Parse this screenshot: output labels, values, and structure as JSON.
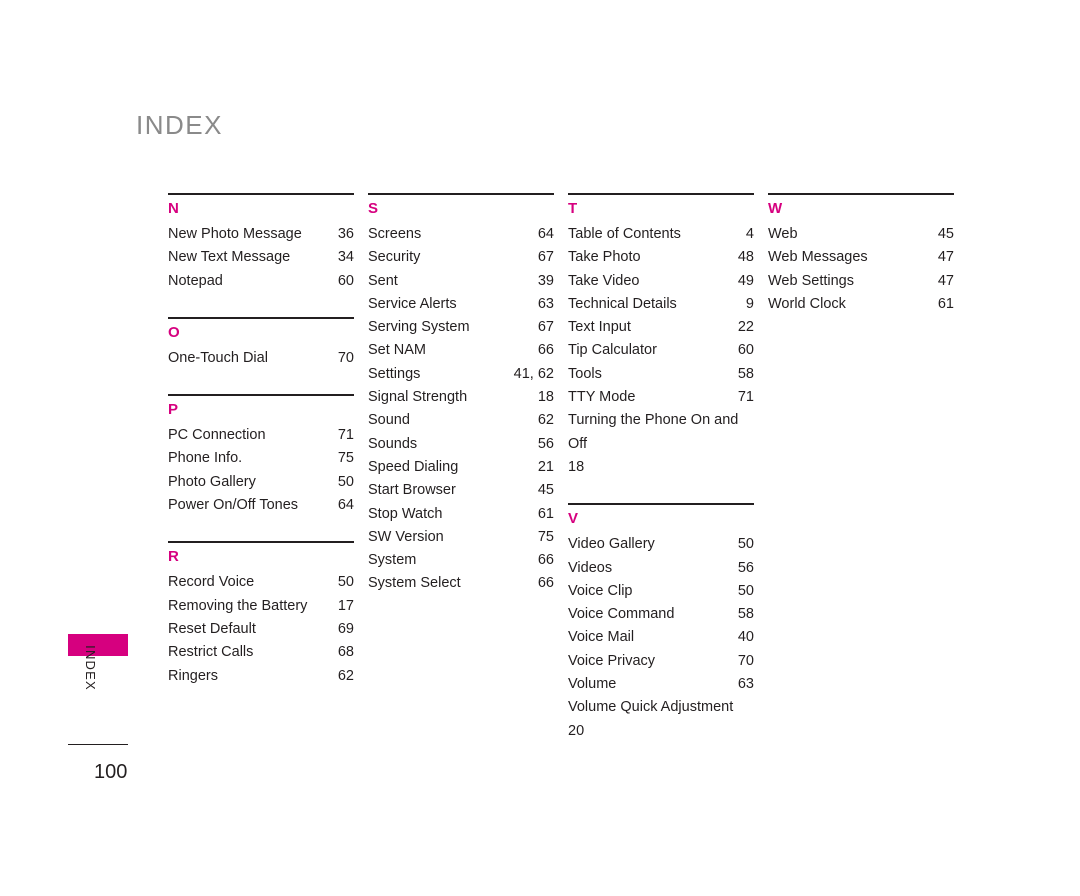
{
  "document": {
    "title": "INDEX",
    "page_number": "100",
    "side_tab_label": "INDEX"
  },
  "columns": [
    {
      "groups": [
        {
          "letter": "N",
          "entries": [
            {
              "label": "New Photo Message",
              "page": "36"
            },
            {
              "label": "New Text Message",
              "page": "34"
            },
            {
              "label": "Notepad",
              "page": "60"
            }
          ]
        },
        {
          "letter": "O",
          "entries": [
            {
              "label": "One-Touch Dial",
              "page": "70"
            }
          ]
        },
        {
          "letter": "P",
          "entries": [
            {
              "label": "PC Connection",
              "page": "71"
            },
            {
              "label": "Phone Info.",
              "page": "75"
            },
            {
              "label": "Photo Gallery",
              "page": "50"
            },
            {
              "label": "Power On/Off Tones",
              "page": "64"
            }
          ]
        },
        {
          "letter": "R",
          "entries": [
            {
              "label": "Record Voice",
              "page": "50"
            },
            {
              "label": "Removing the Battery",
              "page": "17"
            },
            {
              "label": "Reset Default",
              "page": "69"
            },
            {
              "label": "Restrict Calls",
              "page": "68"
            },
            {
              "label": "Ringers",
              "page": "62"
            }
          ]
        }
      ]
    },
    {
      "groups": [
        {
          "letter": "S",
          "entries": [
            {
              "label": "Screens",
              "page": "64"
            },
            {
              "label": "Security",
              "page": "67"
            },
            {
              "label": "Sent",
              "page": "39"
            },
            {
              "label": "Service Alerts",
              "page": "63"
            },
            {
              "label": "Serving System",
              "page": "67"
            },
            {
              "label": "Set NAM",
              "page": "66"
            },
            {
              "label": "Settings",
              "page": "41, 62"
            },
            {
              "label": "Signal Strength",
              "page": "18"
            },
            {
              "label": "Sound",
              "page": "62"
            },
            {
              "label": "Sounds",
              "page": "56"
            },
            {
              "label": "Speed Dialing",
              "page": "21"
            },
            {
              "label": "Start Browser",
              "page": "45"
            },
            {
              "label": "Stop Watch",
              "page": "61"
            },
            {
              "label": "SW Version",
              "page": "75"
            },
            {
              "label": "System",
              "page": "66"
            },
            {
              "label": "System Select",
              "page": "66"
            }
          ]
        }
      ]
    },
    {
      "groups": [
        {
          "letter": "T",
          "entries": [
            {
              "label": "Table of Contents",
              "page": "4"
            },
            {
              "label": "Take Photo",
              "page": "48"
            },
            {
              "label": "Take Video",
              "page": "49"
            },
            {
              "label": "Technical Details",
              "page": "9"
            },
            {
              "label": "Text Input",
              "page": "22"
            },
            {
              "label": "Tip Calculator",
              "page": "60"
            },
            {
              "label": "Tools",
              "page": "58"
            },
            {
              "label": "TTY Mode",
              "page": "71"
            },
            {
              "label": "Turning the Phone On and Off",
              "page": "18",
              "wrap": true
            }
          ]
        },
        {
          "letter": "V",
          "entries": [
            {
              "label": "Video Gallery",
              "page": "50"
            },
            {
              "label": "Videos",
              "page": "56"
            },
            {
              "label": "Voice Clip",
              "page": "50"
            },
            {
              "label": "Voice Command",
              "page": "58"
            },
            {
              "label": "Voice Mail",
              "page": "40"
            },
            {
              "label": "Voice Privacy",
              "page": "70"
            },
            {
              "label": "Volume",
              "page": "63"
            },
            {
              "label": "Volume Quick Adjustment",
              "page": "20",
              "wrap": true
            }
          ]
        }
      ]
    },
    {
      "groups": [
        {
          "letter": "W",
          "entries": [
            {
              "label": "Web",
              "page": "45"
            },
            {
              "label": "Web Messages",
              "page": "47"
            },
            {
              "label": "Web Settings",
              "page": "47"
            },
            {
              "label": "World Clock",
              "page": "61"
            }
          ]
        }
      ]
    }
  ]
}
